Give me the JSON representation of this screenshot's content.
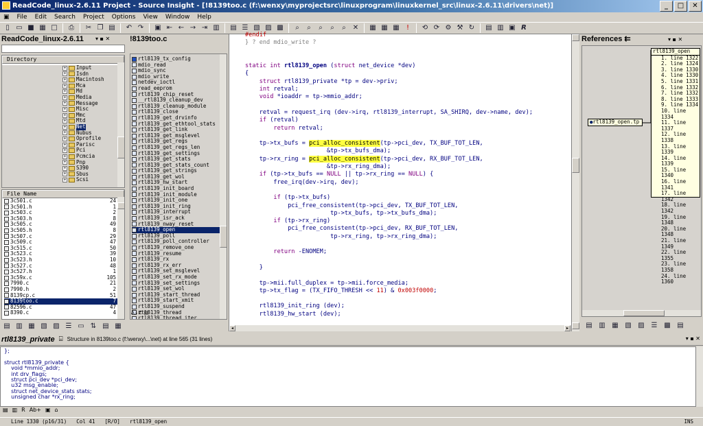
{
  "window": {
    "title": "ReadCode_linux-2.6.11 Project - Source Insight - [!8139too.c (f:\\wenxy\\myprojectsrc\\linuxprogram\\linuxkernel_src\\linux-2.6.11\\drivers\\net)]",
    "min": "_",
    "max": "□",
    "close": "✕"
  },
  "menu": [
    "File",
    "Edit",
    "Search",
    "Project",
    "Options",
    "View",
    "Window",
    "Help"
  ],
  "project_panel": {
    "title": "ReadCode_linux-2.6.11",
    "dir_header": "Directory",
    "dirs": [
      "Input",
      "Isdn",
      "Macintosh",
      "Mca",
      "Md",
      "Media",
      "Message",
      "Misc",
      "Mmc",
      "Mtd",
      "Net",
      "Nubus",
      "Oprofile",
      "Parisc",
      "Pci",
      "Pcmcia",
      "Pnp",
      "S390",
      "Sbus",
      "Scsi"
    ],
    "dir_selected": 10,
    "file_header": "File Name",
    "files": [
      {
        "name": "3c501.c",
        "n": "24"
      },
      {
        "name": "3c501.h",
        "n": "1"
      },
      {
        "name": "3c503.c",
        "n": "2"
      },
      {
        "name": "3c503.h",
        "n": "8"
      },
      {
        "name": "3c505.c",
        "n": "49"
      },
      {
        "name": "3c505.h",
        "n": "8"
      },
      {
        "name": "3c507.c",
        "n": "29"
      },
      {
        "name": "3c509.c",
        "n": "47"
      },
      {
        "name": "3c515.c",
        "n": "50"
      },
      {
        "name": "3c523.c",
        "n": "39"
      },
      {
        "name": "3c523.h",
        "n": "10"
      },
      {
        "name": "3c527.c",
        "n": "48"
      },
      {
        "name": "3c527.h",
        "n": "1"
      },
      {
        "name": "3c59x.c",
        "n": "105"
      },
      {
        "name": "7990.c",
        "n": "21"
      },
      {
        "name": "7990.h",
        "n": "2"
      },
      {
        "name": "8139cp.c",
        "n": "51"
      },
      {
        "name": "8139too.c",
        "n": "7"
      },
      {
        "name": "82596.c",
        "n": "47"
      },
      {
        "name": "8390.c",
        "n": "4"
      }
    ],
    "file_selected": 17
  },
  "symbol_panel": {
    "title": "!8139too.c",
    "symbols": [
      "rtl8139_tx_config",
      "mdio_read",
      "mdio_sync",
      "mdio_write",
      "netdev_ioctl",
      "read_eeprom",
      "rtl8139_chip_reset",
      "__rtl8139_cleanup_dev",
      "rtl8139_cleanup_module",
      "rtl8139_close",
      "rtl8139_get_drvinfo",
      "rtl8139_get_ethtool_stats",
      "rtl8139_get_link",
      "rtl8139_get_msglevel",
      "rtl8139_get_regs",
      "rtl8139_get_regs_len",
      "rtl8139_get_settings",
      "rtl8139_get_stats",
      "rtl8139_get_stats_count",
      "rtl8139_get_strings",
      "rtl8139_get_wol",
      "rtl8139_hw_start",
      "rtl8139_init_board",
      "rtl8139_init_module",
      "rtl8139_init_one",
      "rtl8139_init_ring",
      "rtl8139_interrupt",
      "rtl8139_isr_ack",
      "rtl8139_nway_reset",
      "rtl8139_open",
      "rtl8139_poll",
      "rtl8139_poll_controller",
      "rtl8139_remove_one",
      "rtl8139_resume",
      "rtl8139_rx",
      "rtl8139_rx_err",
      "rtl8139_set_msglevel",
      "rtl8139_set_rx_mode",
      "rtl8139_set_settings",
      "rtl8139_set_wol",
      "rtl8139_start_thread",
      "rtl8139_start_xmit",
      "rtl8139_suspend",
      "rtl8139_thread",
      "rtl8139_thread_iter"
    ],
    "selected": 29
  },
  "references": {
    "title": "References",
    "graph_node": "rtl8139_open.tp",
    "box_title": "rtl8139_open",
    "lines": [
      "1. line 1322",
      "2. line 1324",
      "3. line 1330",
      "4. line 1330",
      "5. line 1331",
      "6. line 1332",
      "7. line 1332",
      "8. line 1333",
      "9. line 1334",
      "10. line 1334",
      "11. line 1337",
      "12. line 1338",
      "13. line 1339",
      "14. line 1339",
      "15. line 1340",
      "16. line 1341",
      "17. line 1342",
      "18. line 1342",
      "19. line 1348",
      "20. line 1348",
      "21. line 1349",
      "22. line 1355",
      "23. line 1358",
      "24. line 1360"
    ]
  },
  "context": {
    "symbol": "rtl8139_private",
    "info": "Structure in 8139too.c (f:\\wenxy\\...\\net) at line 565 (31 lines)",
    "code": [
      "};",
      "",
      "struct rtl8139_private {",
      "    void *mmio_addr;",
      "    int drv_flags;",
      "    struct pci_dev *pci_dev;",
      "    u32 msg_enable;",
      "    struct net_device_stats stats;",
      "    unsigned char *rx_ring;"
    ]
  },
  "status": {
    "line": "Line 1330 (p16/31)",
    "col": "Col 41",
    "ro": "[R/O]",
    "func": "rtl8139_open",
    "ins": "INS"
  }
}
